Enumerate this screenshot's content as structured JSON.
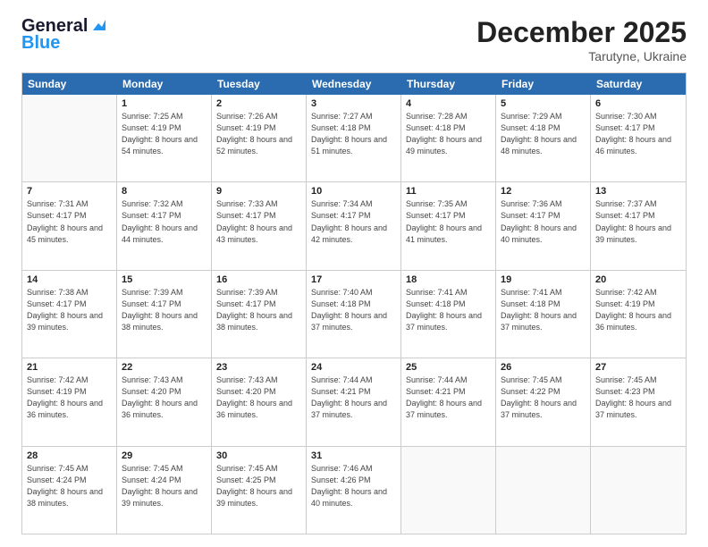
{
  "logo": {
    "line1": "General",
    "line2": "Blue"
  },
  "title": "December 2025",
  "subtitle": "Tarutyne, Ukraine",
  "header_days": [
    "Sunday",
    "Monday",
    "Tuesday",
    "Wednesday",
    "Thursday",
    "Friday",
    "Saturday"
  ],
  "weeks": [
    [
      {
        "day": "",
        "sunrise": "",
        "sunset": "",
        "daylight": "",
        "empty": true
      },
      {
        "day": "1",
        "sunrise": "Sunrise: 7:25 AM",
        "sunset": "Sunset: 4:19 PM",
        "daylight": "Daylight: 8 hours and 54 minutes."
      },
      {
        "day": "2",
        "sunrise": "Sunrise: 7:26 AM",
        "sunset": "Sunset: 4:19 PM",
        "daylight": "Daylight: 8 hours and 52 minutes."
      },
      {
        "day": "3",
        "sunrise": "Sunrise: 7:27 AM",
        "sunset": "Sunset: 4:18 PM",
        "daylight": "Daylight: 8 hours and 51 minutes."
      },
      {
        "day": "4",
        "sunrise": "Sunrise: 7:28 AM",
        "sunset": "Sunset: 4:18 PM",
        "daylight": "Daylight: 8 hours and 49 minutes."
      },
      {
        "day": "5",
        "sunrise": "Sunrise: 7:29 AM",
        "sunset": "Sunset: 4:18 PM",
        "daylight": "Daylight: 8 hours and 48 minutes."
      },
      {
        "day": "6",
        "sunrise": "Sunrise: 7:30 AM",
        "sunset": "Sunset: 4:17 PM",
        "daylight": "Daylight: 8 hours and 46 minutes."
      }
    ],
    [
      {
        "day": "7",
        "sunrise": "Sunrise: 7:31 AM",
        "sunset": "Sunset: 4:17 PM",
        "daylight": "Daylight: 8 hours and 45 minutes."
      },
      {
        "day": "8",
        "sunrise": "Sunrise: 7:32 AM",
        "sunset": "Sunset: 4:17 PM",
        "daylight": "Daylight: 8 hours and 44 minutes."
      },
      {
        "day": "9",
        "sunrise": "Sunrise: 7:33 AM",
        "sunset": "Sunset: 4:17 PM",
        "daylight": "Daylight: 8 hours and 43 minutes."
      },
      {
        "day": "10",
        "sunrise": "Sunrise: 7:34 AM",
        "sunset": "Sunset: 4:17 PM",
        "daylight": "Daylight: 8 hours and 42 minutes."
      },
      {
        "day": "11",
        "sunrise": "Sunrise: 7:35 AM",
        "sunset": "Sunset: 4:17 PM",
        "daylight": "Daylight: 8 hours and 41 minutes."
      },
      {
        "day": "12",
        "sunrise": "Sunrise: 7:36 AM",
        "sunset": "Sunset: 4:17 PM",
        "daylight": "Daylight: 8 hours and 40 minutes."
      },
      {
        "day": "13",
        "sunrise": "Sunrise: 7:37 AM",
        "sunset": "Sunset: 4:17 PM",
        "daylight": "Daylight: 8 hours and 39 minutes."
      }
    ],
    [
      {
        "day": "14",
        "sunrise": "Sunrise: 7:38 AM",
        "sunset": "Sunset: 4:17 PM",
        "daylight": "Daylight: 8 hours and 39 minutes."
      },
      {
        "day": "15",
        "sunrise": "Sunrise: 7:39 AM",
        "sunset": "Sunset: 4:17 PM",
        "daylight": "Daylight: 8 hours and 38 minutes."
      },
      {
        "day": "16",
        "sunrise": "Sunrise: 7:39 AM",
        "sunset": "Sunset: 4:17 PM",
        "daylight": "Daylight: 8 hours and 38 minutes."
      },
      {
        "day": "17",
        "sunrise": "Sunrise: 7:40 AM",
        "sunset": "Sunset: 4:18 PM",
        "daylight": "Daylight: 8 hours and 37 minutes."
      },
      {
        "day": "18",
        "sunrise": "Sunrise: 7:41 AM",
        "sunset": "Sunset: 4:18 PM",
        "daylight": "Daylight: 8 hours and 37 minutes."
      },
      {
        "day": "19",
        "sunrise": "Sunrise: 7:41 AM",
        "sunset": "Sunset: 4:18 PM",
        "daylight": "Daylight: 8 hours and 37 minutes."
      },
      {
        "day": "20",
        "sunrise": "Sunrise: 7:42 AM",
        "sunset": "Sunset: 4:19 PM",
        "daylight": "Daylight: 8 hours and 36 minutes."
      }
    ],
    [
      {
        "day": "21",
        "sunrise": "Sunrise: 7:42 AM",
        "sunset": "Sunset: 4:19 PM",
        "daylight": "Daylight: 8 hours and 36 minutes."
      },
      {
        "day": "22",
        "sunrise": "Sunrise: 7:43 AM",
        "sunset": "Sunset: 4:20 PM",
        "daylight": "Daylight: 8 hours and 36 minutes."
      },
      {
        "day": "23",
        "sunrise": "Sunrise: 7:43 AM",
        "sunset": "Sunset: 4:20 PM",
        "daylight": "Daylight: 8 hours and 36 minutes."
      },
      {
        "day": "24",
        "sunrise": "Sunrise: 7:44 AM",
        "sunset": "Sunset: 4:21 PM",
        "daylight": "Daylight: 8 hours and 37 minutes."
      },
      {
        "day": "25",
        "sunrise": "Sunrise: 7:44 AM",
        "sunset": "Sunset: 4:21 PM",
        "daylight": "Daylight: 8 hours and 37 minutes."
      },
      {
        "day": "26",
        "sunrise": "Sunrise: 7:45 AM",
        "sunset": "Sunset: 4:22 PM",
        "daylight": "Daylight: 8 hours and 37 minutes."
      },
      {
        "day": "27",
        "sunrise": "Sunrise: 7:45 AM",
        "sunset": "Sunset: 4:23 PM",
        "daylight": "Daylight: 8 hours and 37 minutes."
      }
    ],
    [
      {
        "day": "28",
        "sunrise": "Sunrise: 7:45 AM",
        "sunset": "Sunset: 4:24 PM",
        "daylight": "Daylight: 8 hours and 38 minutes."
      },
      {
        "day": "29",
        "sunrise": "Sunrise: 7:45 AM",
        "sunset": "Sunset: 4:24 PM",
        "daylight": "Daylight: 8 hours and 39 minutes."
      },
      {
        "day": "30",
        "sunrise": "Sunrise: 7:45 AM",
        "sunset": "Sunset: 4:25 PM",
        "daylight": "Daylight: 8 hours and 39 minutes."
      },
      {
        "day": "31",
        "sunrise": "Sunrise: 7:46 AM",
        "sunset": "Sunset: 4:26 PM",
        "daylight": "Daylight: 8 hours and 40 minutes."
      },
      {
        "day": "",
        "sunrise": "",
        "sunset": "",
        "daylight": "",
        "empty": true
      },
      {
        "day": "",
        "sunrise": "",
        "sunset": "",
        "daylight": "",
        "empty": true
      },
      {
        "day": "",
        "sunrise": "",
        "sunset": "",
        "daylight": "",
        "empty": true
      }
    ]
  ]
}
